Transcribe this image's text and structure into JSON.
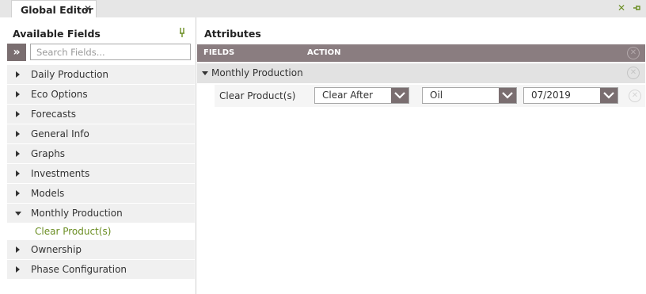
{
  "tab": {
    "title": "Global Editor",
    "close_glyph": "✕"
  },
  "window": {
    "close_glyph": "✕"
  },
  "left_panel": {
    "title": "Available Fields",
    "expand_glyph": "»",
    "search_placeholder": "Search Fields...",
    "items": [
      {
        "label": "Daily Production",
        "expanded": false
      },
      {
        "label": "Eco Options",
        "expanded": false
      },
      {
        "label": "Forecasts",
        "expanded": false
      },
      {
        "label": "General Info",
        "expanded": false
      },
      {
        "label": "Graphs",
        "expanded": false
      },
      {
        "label": "Investments",
        "expanded": false
      },
      {
        "label": "Models",
        "expanded": false
      },
      {
        "label": "Monthly Production",
        "expanded": true,
        "children": [
          "Clear Product(s)"
        ]
      },
      {
        "label": "Ownership",
        "expanded": false
      },
      {
        "label": "Phase Configuration",
        "expanded": false
      }
    ]
  },
  "right_panel": {
    "title": "Attributes",
    "columns": {
      "fields": "FIELDS",
      "action": "ACTION"
    },
    "group": {
      "label": "Monthly Production"
    },
    "row": {
      "label": "Clear Product(s)",
      "action": "Clear After",
      "product": "Oil",
      "date": "07/2019"
    }
  },
  "icons": {
    "pin": "pin-icon",
    "close": "close-icon",
    "chevron": "chevron-down-icon"
  },
  "colors": {
    "header_bg": "#8a7d80",
    "button_bg": "#7a6e70",
    "accent_green": "#6b8e23"
  }
}
